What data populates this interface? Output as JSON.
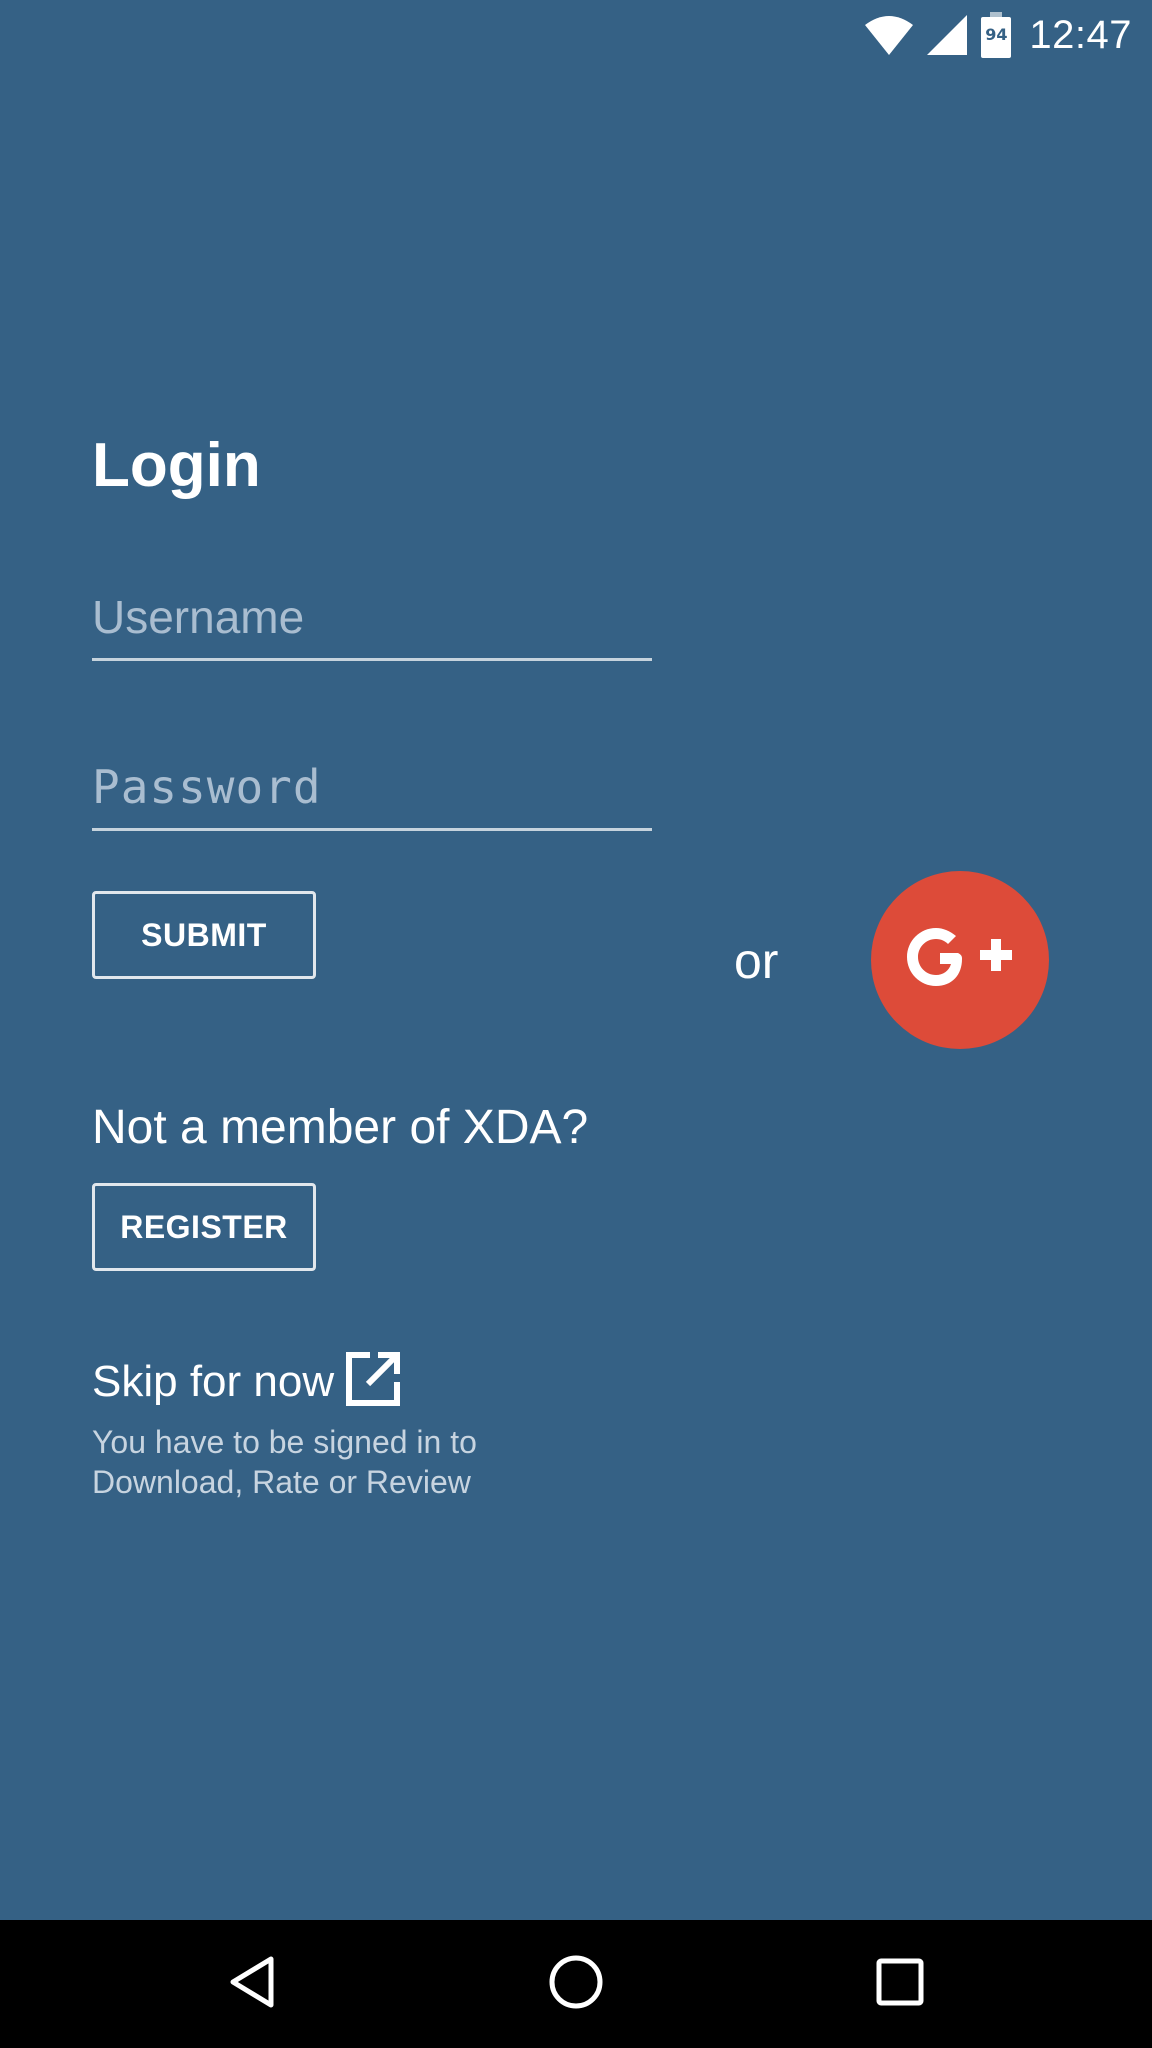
{
  "status_bar": {
    "time": "12:47",
    "battery_level": "94",
    "icons": [
      "wifi-icon",
      "cell-signal-icon",
      "battery-icon"
    ]
  },
  "login": {
    "title": "Login",
    "username_placeholder": "Username",
    "username_value": "",
    "password_placeholder": "Password",
    "password_value": "",
    "submit_label": "SUBMIT",
    "or_label": "or",
    "google_plus_icon": "google-plus-icon"
  },
  "register": {
    "prompt": "Not a member of XDA?",
    "button_label": "REGISTER"
  },
  "skip": {
    "label": "Skip for now",
    "icon": "open-in-new-icon",
    "note": "You have to be signed in to Download, Rate or Review"
  },
  "nav_bar": {
    "icons": [
      "back-icon",
      "home-icon",
      "recents-icon"
    ]
  },
  "colors": {
    "background": "#356185",
    "google_plus": "#dd4b39",
    "nav_bar": "#000000",
    "placeholder": "#a9bdd0"
  }
}
